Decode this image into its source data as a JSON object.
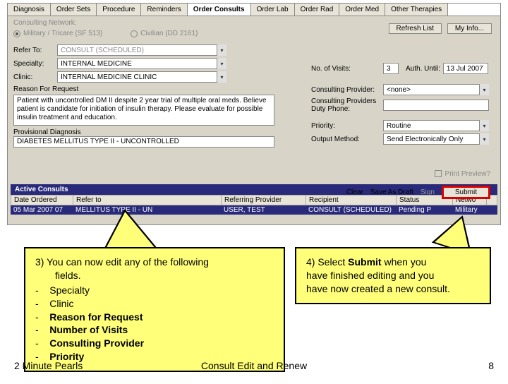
{
  "tabs": [
    "Diagnosis",
    "Order Sets",
    "Procedure",
    "Reminders",
    "Order Consults",
    "Order Lab",
    "Order Rad",
    "Order Med",
    "Other Therapies"
  ],
  "active_tab": "Order Consults",
  "network_label": "Consulting Network:",
  "radio1": "Military / Tricare (SF 513)",
  "radio2": "Civilian (DD 2161)",
  "refresh_btn": "Refresh List",
  "myinfo_btn": "My Info...",
  "refer_to_lbl": "Refer To:",
  "refer_to_val": "CONSULT (SCHEDULED)",
  "specialty_lbl": "Specialty:",
  "specialty_val": "INTERNAL MEDICINE",
  "clinic_lbl": "Clinic:",
  "clinic_val": "INTERNAL MEDICINE CLINIC",
  "visits_lbl": "No. of Visits:",
  "visits_val": "3",
  "auth_lbl": "Auth. Until:",
  "auth_val": "13 Jul 2007",
  "cons_prov_lbl": "Consulting Provider:",
  "cons_prov_val": "<none>",
  "duty_phone_lbl": "Consulting Providers\nDuty Phone:",
  "priority_lbl": "Priority:",
  "priority_val": "Routine",
  "output_lbl": "Output Method:",
  "output_val": "Send Electronically Only",
  "reason_lbl": "Reason For Request",
  "reason_text": "Patient with uncontrolled DM II despite 2 year trial of multiple oral meds. Believe patient is candidate for initiation of insulin therapy. Please evaluate for possible insulin treatment and education.",
  "provdx_lbl": "Provisional Diagnosis",
  "provdx_val": "DIABETES MELLITUS TYPE II - UNCONTROLLED",
  "print_preview": "Print Preview?",
  "action_clear": "Clear",
  "action_save": "Save As Draft",
  "action_sign": "Sign",
  "action_submit": "Submit",
  "consults_hdr": "Active Consults",
  "th": {
    "date": "Date Ordered",
    "referto": "Refer to",
    "refprov": "Referring Provider",
    "recipient": "Recipient",
    "status": "Status",
    "network": "Netwo"
  },
  "trow": {
    "date": "05 Mar 2007 07",
    "referto": "MELLITUS TYPE II - UN",
    "refprov": "USER, TEST",
    "recipient": "CONSULT (SCHEDULED)",
    "status": "Pending P",
    "network": "Military"
  },
  "callout3": {
    "lead": "3)  You can now edit any of the following",
    "lead2": "fields.",
    "items": [
      "Specialty",
      "Clinic",
      "Reason for Request",
      "Number of Visits",
      "Consulting Provider",
      "Priority"
    ]
  },
  "callout4": {
    "l1": "4) Select ",
    "bold": "Submit",
    "l1b": " when you",
    "l2": "have finished editing and you",
    "l3": "have now created a new consult."
  },
  "footer": {
    "left": "2 Minute Pearls",
    "center": "Consult Edit and Renew",
    "right": "8"
  }
}
